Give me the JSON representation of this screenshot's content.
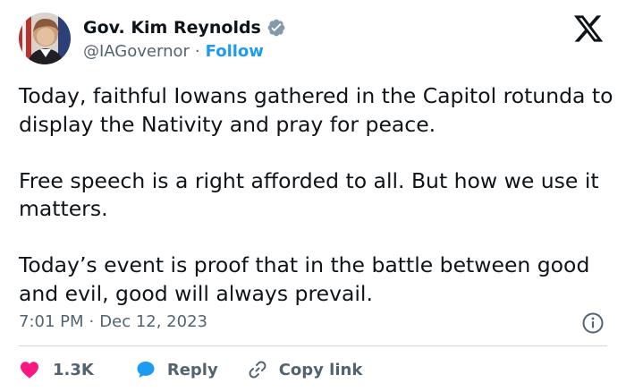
{
  "author": {
    "display_name": "Gov. Kim Reynolds",
    "handle": "@IAGovernor",
    "separator": "·",
    "follow_label": "Follow",
    "verified_icon": "verified-badge-icon",
    "avatar_icon": "profile-photo"
  },
  "tweet": {
    "paragraphs": [
      "Today, faithful Iowans gathered in the Capitol rotunda to display the Nativity and pray for peace.",
      "Free speech is a right afforded to all. But how we use it matters.",
      "Today’s event is proof that in the battle between good and evil, good will always prevail."
    ],
    "time": "7:01 PM",
    "date_separator": "·",
    "date": "Dec 12, 2023"
  },
  "actions": {
    "like_count": "1.3K",
    "reply_label": "Reply",
    "copy_label": "Copy link"
  },
  "colors": {
    "accent": "#1d9bf0",
    "like": "#f91880",
    "text": "#0f1419",
    "muted": "#536471",
    "divider": "#cfd9de"
  },
  "icons": [
    "x-logo-icon",
    "info-icon",
    "heart-icon",
    "reply-bubble-icon",
    "link-icon"
  ]
}
